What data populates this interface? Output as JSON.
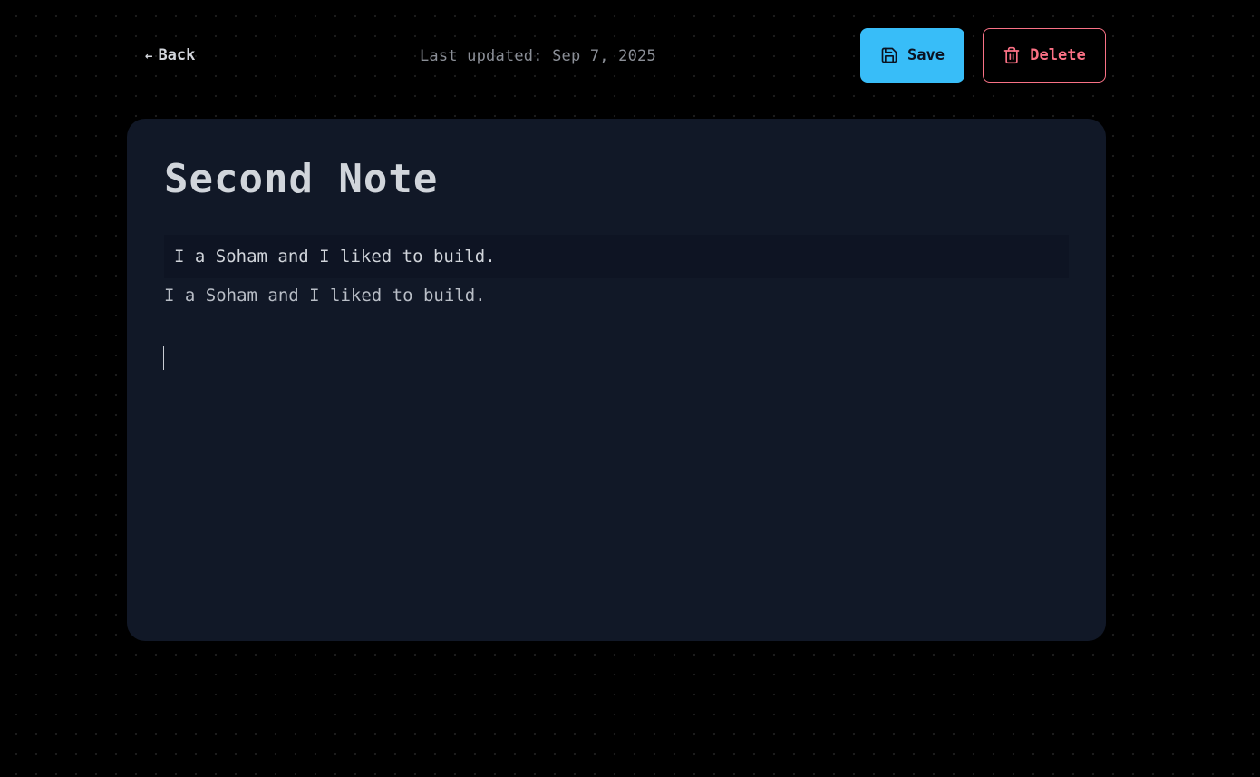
{
  "toolbar": {
    "back_label": "Back",
    "back_icon": "arrow-left-icon",
    "last_updated": "Last updated: Sep 7, 2025",
    "save_label": "Save",
    "save_icon": "floppy-disk-icon",
    "delete_label": "Delete",
    "delete_icon": "trash-icon"
  },
  "note": {
    "title": "Second Note",
    "lines": [
      "I a Soham and I liked to build.",
      "I a Soham and I liked to build."
    ]
  },
  "colors": {
    "background": "#000000",
    "card": "#111827",
    "save_accent": "#38bdf8",
    "delete_accent": "#fb7185"
  }
}
